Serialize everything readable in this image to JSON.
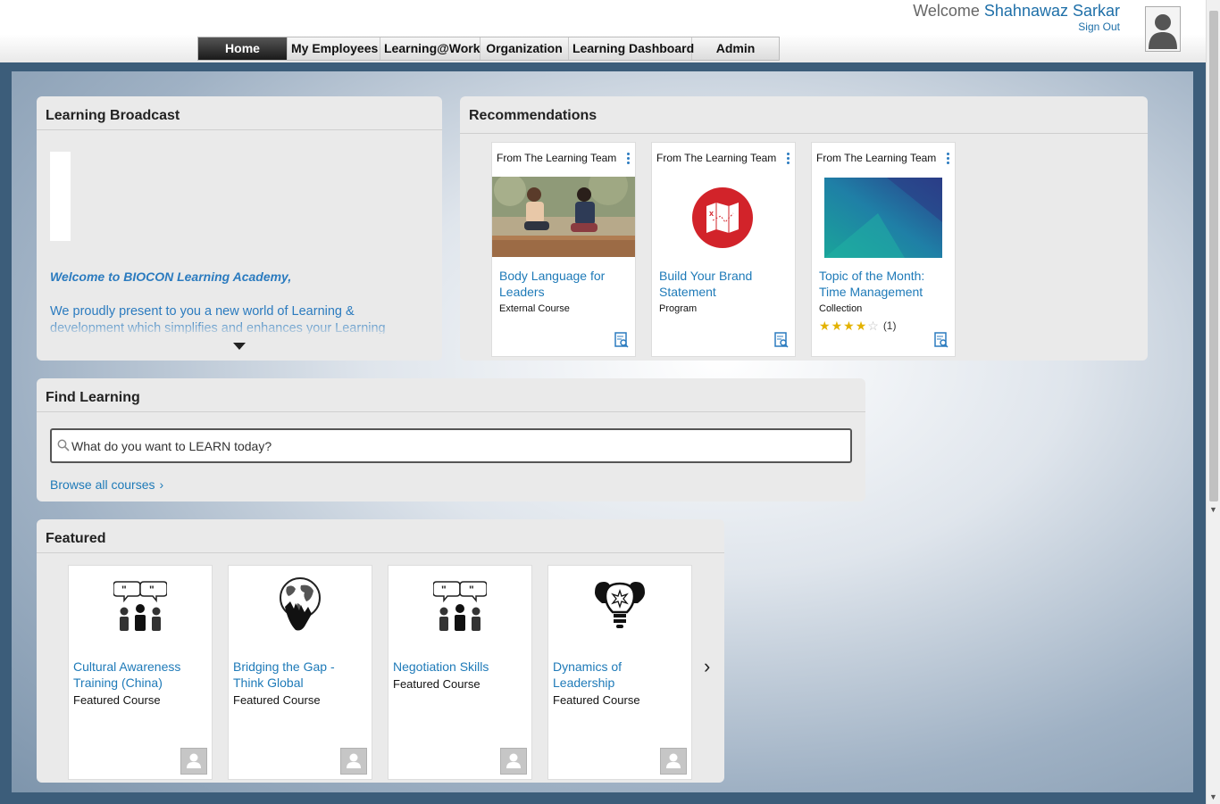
{
  "header": {
    "welcome_prefix": "Welcome",
    "user_name": "Shahnawaz Sarkar",
    "sign_out": "Sign Out"
  },
  "nav": {
    "tabs": [
      {
        "label": "Home",
        "active": true
      },
      {
        "label": "My Employees",
        "active": false
      },
      {
        "label": "Learning@Work",
        "active": false
      },
      {
        "label": "Organization",
        "active": false
      },
      {
        "label": "Learning Dashboard",
        "active": false
      },
      {
        "label": "Admin",
        "active": false
      }
    ]
  },
  "broadcast": {
    "title": "Learning Broadcast",
    "heading": "Welcome to BIOCON Learning Academy,",
    "text": "We proudly present to you a new world of Learning & development which simplifies and enhances your Learning"
  },
  "recommendations": {
    "title": "Recommendations",
    "cards": [
      {
        "source": "From The Learning Team",
        "title": "Body Language for Leaders",
        "type": "External Course",
        "image": "photo-two-people-talking"
      },
      {
        "source": "From The Learning Team",
        "title": "Build Your Brand Statement",
        "type": "Program",
        "image": "red-map-icon"
      },
      {
        "source": "From The Learning Team",
        "title": "Topic of the Month: Time Management",
        "type": "Collection",
        "image": "teal-abstract-banner",
        "rating": 4,
        "rating_max": 5,
        "rating_count": "(1)"
      }
    ]
  },
  "find_learning": {
    "title": "Find Learning",
    "search_placeholder": "What do you want to LEARN today?",
    "browse_link": "Browse all courses"
  },
  "featured": {
    "title": "Featured",
    "cards": [
      {
        "title": "Cultural Awareness Training (China)",
        "type": "Featured Course",
        "icon": "people-talking-icon"
      },
      {
        "title": "Bridging the Gap - Think Global",
        "type": "Featured Course",
        "icon": "hand-globe-icon"
      },
      {
        "title": "Negotiation Skills",
        "type": "Featured Course",
        "icon": "people-talking-icon"
      },
      {
        "title": "Dynamics of Leadership",
        "type": "Featured Course",
        "icon": "lightbulbs-icon"
      }
    ]
  },
  "colors": {
    "link": "#1e7ab8",
    "active_tab": "#1a1a1a",
    "brand_red": "#d2232a"
  }
}
